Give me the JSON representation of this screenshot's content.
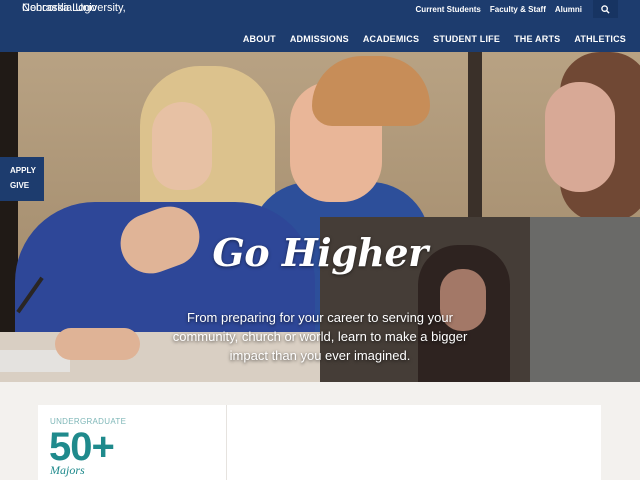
{
  "header": {
    "logo_alt_1": "Nebraska Logo",
    "logo_alt_2": "Concordia University,",
    "utility_links": [
      "Current Students",
      "Faculty & Staff",
      "Alumni"
    ],
    "search_icon": "search-icon",
    "nav": [
      "ABOUT",
      "ADMISSIONS",
      "ACADEMICS",
      "STUDENT LIFE",
      "THE ARTS",
      "ATHLETICS"
    ]
  },
  "hero": {
    "title": "Go Higher",
    "subtitle": "From preparing for your career to serving your community, church or world, learn to make a bigger impact than you ever imagined.",
    "side_buttons": [
      "APPLY",
      "GIVE"
    ]
  },
  "stats": {
    "label": "UNDERGRADUATE",
    "value": "50+",
    "description": "Majors"
  },
  "colors": {
    "header_bg": "#1d3c6e",
    "accent_teal": "#1f8a8c"
  }
}
